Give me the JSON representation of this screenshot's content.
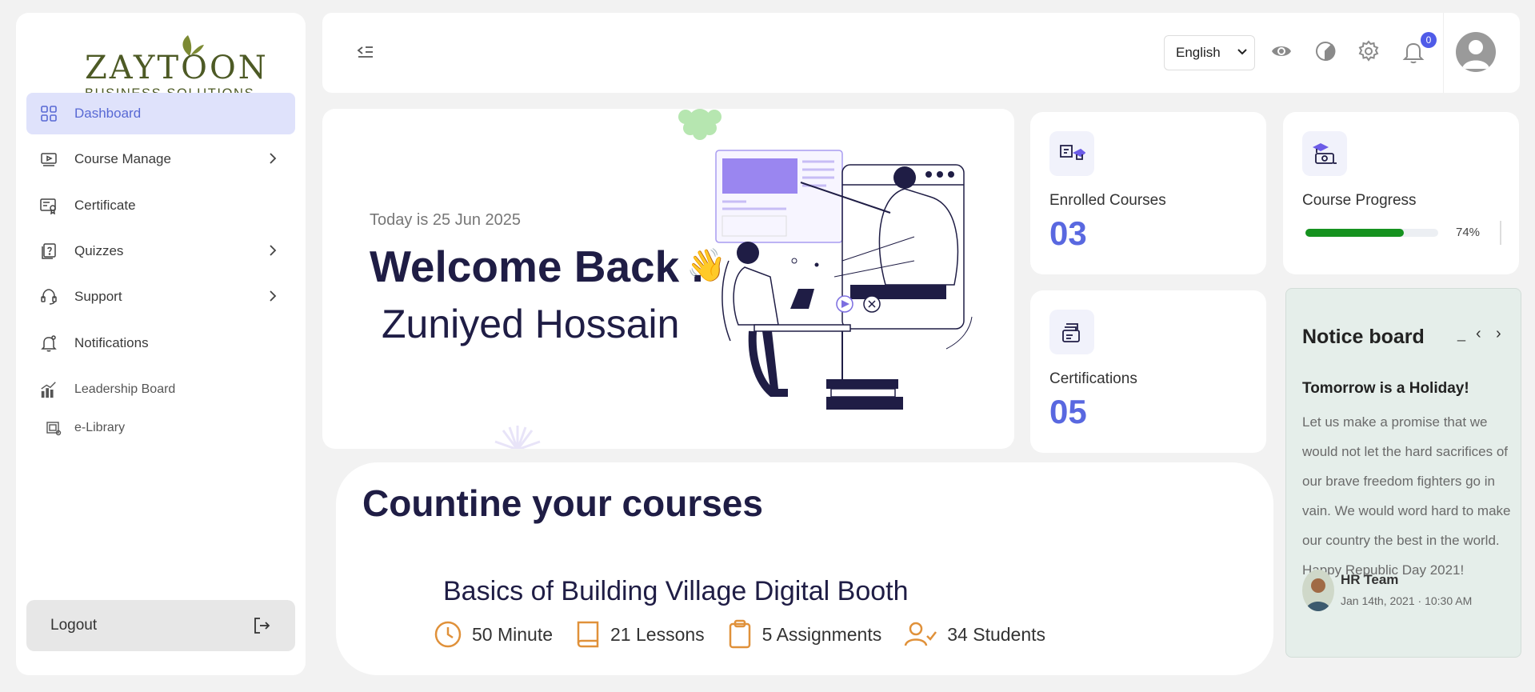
{
  "brand": {
    "name": "ZAYTOON",
    "tagline": "BUSINESS SOLUTIONS"
  },
  "sidebar": {
    "items": [
      {
        "label": "Dashboard",
        "icon": "grid-icon",
        "active": true
      },
      {
        "label": "Course Manage",
        "icon": "video-icon",
        "has_submenu": true
      },
      {
        "label": "Certificate",
        "icon": "certificate-icon"
      },
      {
        "label": "Quizzes",
        "icon": "quiz-icon",
        "has_submenu": true
      },
      {
        "label": "Support",
        "icon": "headset-icon",
        "has_submenu": true
      },
      {
        "label": "Notifications",
        "icon": "bell-icon"
      },
      {
        "label": "Leadership Board",
        "icon": "chart-icon"
      },
      {
        "label": "e-Library",
        "icon": "library-icon"
      }
    ],
    "logout_label": "Logout"
  },
  "header": {
    "language": "English",
    "notification_count": "0",
    "icons": [
      "eye-icon",
      "theme-icon",
      "settings-icon",
      "bell-icon"
    ]
  },
  "welcome": {
    "date_text": "Today is 25 Jun 2025",
    "greeting": "Welcome Back .",
    "user_name": "Zuniyed Hossain"
  },
  "stats": {
    "enrolled": {
      "label": "Enrolled Courses",
      "value": "03"
    },
    "progress": {
      "label": "Course Progress",
      "percent": 74,
      "percent_text": "74%"
    },
    "certifications": {
      "label": "Certifications",
      "value": "05"
    }
  },
  "notice_board": {
    "title": "Notice board",
    "minimize": "_",
    "prev": "‹",
    "next": "›",
    "headline": "Tomorrow is a Holiday!",
    "body": "Let us make a promise that we would not let the hard sacrifices of our brave freedom fighters go in vain. We would word hard to make our country the best in the world. Happy Republic Day 2021!",
    "author": "HR Team",
    "date": "Jan 14th, 2021 · 10:30 AM"
  },
  "continue": {
    "title": "Countine your courses",
    "course_title": "Basics of  Building Village Digital Booth",
    "duration": "50 Minute",
    "lessons": "21 Lessons",
    "assignments": "5 Assignments",
    "students": "34 Students"
  },
  "colors": {
    "accent": "#5968e0",
    "active_bg": "#dfe2fb",
    "brand": "#4d5a25",
    "progress": "#15921f",
    "heading": "#1f1d45",
    "meta_icon": "#e0913a"
  }
}
